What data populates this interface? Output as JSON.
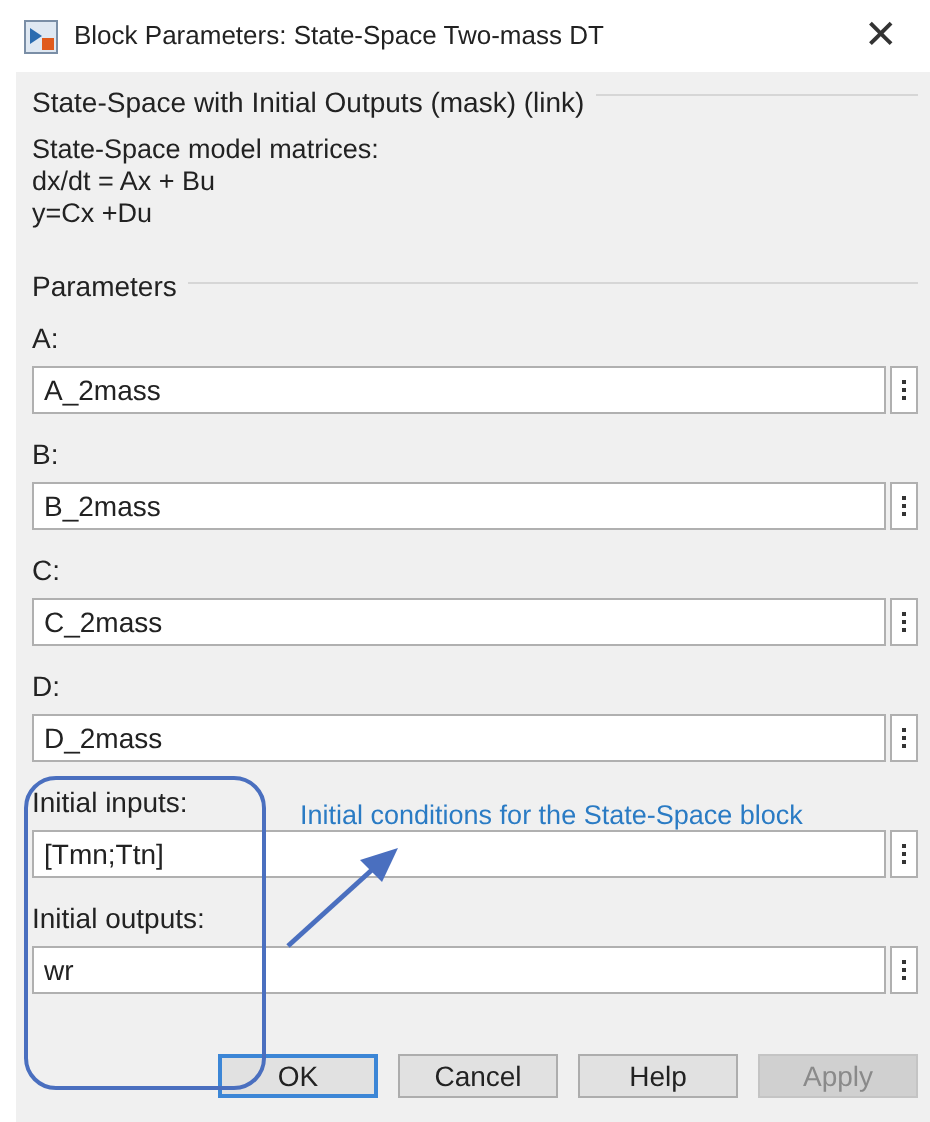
{
  "window": {
    "title": "Block Parameters: State-Space Two-mass DT",
    "close": "✕"
  },
  "mask": {
    "title": "State-Space with Initial Outputs (mask) (link)",
    "description": [
      "State-Space model matrices:",
      "dx/dt = Ax + Bu",
      "y=Cx +Du"
    ]
  },
  "parameters": {
    "title": "Parameters",
    "items": [
      {
        "label": "A:",
        "value": "A_2mass"
      },
      {
        "label": "B:",
        "value": "B_2mass"
      },
      {
        "label": "C:",
        "value": "C_2mass"
      },
      {
        "label": "D:",
        "value": "D_2mass"
      },
      {
        "label": "Initial inputs:",
        "value": "[Tmn;Ttn]"
      },
      {
        "label": "Initial outputs:",
        "value": "wr"
      }
    ]
  },
  "annotation": {
    "text": "Initial conditions for the State-Space block"
  },
  "buttons": [
    {
      "label": "OK",
      "default": true,
      "disabled": false
    },
    {
      "label": "Cancel",
      "default": false,
      "disabled": false
    },
    {
      "label": "Help",
      "default": false,
      "disabled": false
    },
    {
      "label": "Apply",
      "default": false,
      "disabled": true
    }
  ]
}
